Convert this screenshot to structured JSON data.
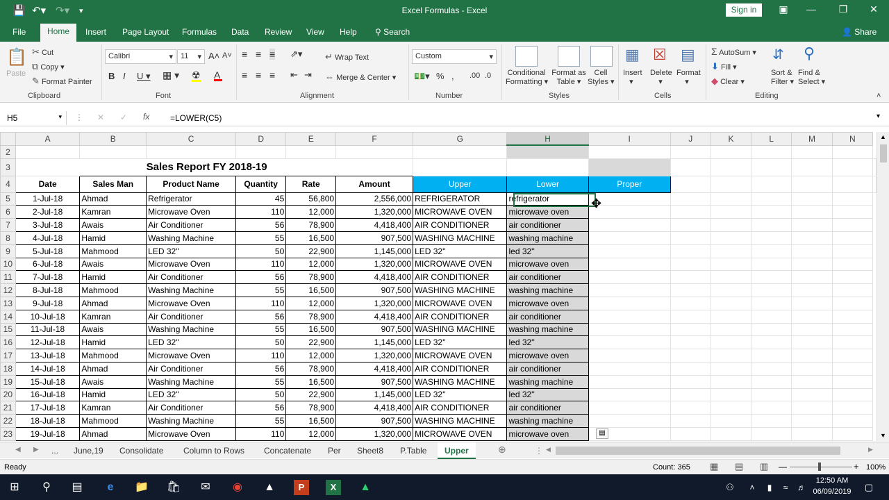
{
  "app": {
    "title": "Excel Formulas  -  Excel",
    "signin": "Sign in"
  },
  "tabs": [
    "File",
    "Home",
    "Insert",
    "Page Layout",
    "Formulas",
    "Data",
    "Review",
    "View",
    "Help"
  ],
  "tell_me": "Search",
  "share": "Share",
  "ribbon": {
    "clipboard": {
      "label": "Clipboard",
      "paste": "Paste",
      "cut": "Cut",
      "copy": "Copy",
      "format_painter": "Format Painter"
    },
    "font": {
      "label": "Font",
      "name": "Calibri",
      "size": "11"
    },
    "alignment": {
      "label": "Alignment",
      "wrap": "Wrap Text",
      "merge": "Merge & Center"
    },
    "number": {
      "label": "Number",
      "format": "Custom"
    },
    "styles": {
      "label": "Styles",
      "conditional": "Conditional",
      "conditional2": "Formatting",
      "format_as": "Format as",
      "format_as2": "Table",
      "cell": "Cell",
      "cell2": "Styles"
    },
    "cells": {
      "label": "Cells",
      "insert": "Insert",
      "delete": "Delete",
      "format": "Format"
    },
    "editing": {
      "label": "Editing",
      "autosum": "AutoSum",
      "fill": "Fill",
      "clear": "Clear",
      "sort": "Sort &",
      "sort2": "Filter",
      "find": "Find &",
      "find2": "Select"
    }
  },
  "formula_bar": {
    "name_box": "H5",
    "formula": "=LOWER(C5)",
    "fx": "fx"
  },
  "columns": [
    "A",
    "B",
    "C",
    "D",
    "E",
    "F",
    "G",
    "H",
    "I",
    "J",
    "K",
    "L",
    "M",
    "N"
  ],
  "sheet": {
    "title": "Sales Report FY 2018-19",
    "headers": [
      "Date",
      "Sales Man",
      "Product Name",
      "Quantity",
      "Rate",
      "Amount",
      "Upper",
      "Lower",
      "Proper"
    ],
    "rows": [
      [
        "5",
        "1-Jul-18",
        "Ahmad",
        "Refrigerator",
        "45",
        "56,800",
        "2,556,000",
        "REFRIGERATOR",
        "refrigerator"
      ],
      [
        "6",
        "2-Jul-18",
        "Kamran",
        "Microwave Oven",
        "110",
        "12,000",
        "1,320,000",
        "MICROWAVE OVEN",
        "microwave oven"
      ],
      [
        "7",
        "3-Jul-18",
        "Awais",
        "Air Conditioner",
        "56",
        "78,900",
        "4,418,400",
        "AIR CONDITIONER",
        "air conditioner"
      ],
      [
        "8",
        "4-Jul-18",
        "Hamid",
        "Washing Machine",
        "55",
        "16,500",
        "907,500",
        "WASHING MACHINE",
        "washing machine"
      ],
      [
        "9",
        "5-Jul-18",
        "Mahmood",
        "LED 32''",
        "50",
        "22,900",
        "1,145,000",
        "LED 32''",
        "led 32''"
      ],
      [
        "10",
        "6-Jul-18",
        "Awais",
        "Microwave Oven",
        "110",
        "12,000",
        "1,320,000",
        "MICROWAVE OVEN",
        "microwave oven"
      ],
      [
        "11",
        "7-Jul-18",
        "Hamid",
        "Air Conditioner",
        "56",
        "78,900",
        "4,418,400",
        "AIR CONDITIONER",
        "air conditioner"
      ],
      [
        "12",
        "8-Jul-18",
        "Mahmood",
        "Washing Machine",
        "55",
        "16,500",
        "907,500",
        "WASHING MACHINE",
        "washing machine"
      ],
      [
        "13",
        "9-Jul-18",
        "Ahmad",
        "Microwave Oven",
        "110",
        "12,000",
        "1,320,000",
        "MICROWAVE OVEN",
        "microwave oven"
      ],
      [
        "14",
        "10-Jul-18",
        "Kamran",
        "Air Conditioner",
        "56",
        "78,900",
        "4,418,400",
        "AIR CONDITIONER",
        "air conditioner"
      ],
      [
        "15",
        "11-Jul-18",
        "Awais",
        "Washing Machine",
        "55",
        "16,500",
        "907,500",
        "WASHING MACHINE",
        "washing machine"
      ],
      [
        "16",
        "12-Jul-18",
        "Hamid",
        "LED 32''",
        "50",
        "22,900",
        "1,145,000",
        "LED 32''",
        "led 32''"
      ],
      [
        "17",
        "13-Jul-18",
        "Mahmood",
        "Microwave Oven",
        "110",
        "12,000",
        "1,320,000",
        "MICROWAVE OVEN",
        "microwave oven"
      ],
      [
        "18",
        "14-Jul-18",
        "Ahmad",
        "Air Conditioner",
        "56",
        "78,900",
        "4,418,400",
        "AIR CONDITIONER",
        "air conditioner"
      ],
      [
        "19",
        "15-Jul-18",
        "Awais",
        "Washing Machine",
        "55",
        "16,500",
        "907,500",
        "WASHING MACHINE",
        "washing machine"
      ],
      [
        "20",
        "16-Jul-18",
        "Hamid",
        "LED 32''",
        "50",
        "22,900",
        "1,145,000",
        "LED 32''",
        "led 32''"
      ],
      [
        "21",
        "17-Jul-18",
        "Kamran",
        "Air Conditioner",
        "56",
        "78,900",
        "4,418,400",
        "AIR CONDITIONER",
        "air conditioner"
      ],
      [
        "22",
        "18-Jul-18",
        "Mahmood",
        "Washing Machine",
        "55",
        "16,500",
        "907,500",
        "WASHING MACHINE",
        "washing machine"
      ],
      [
        "23",
        "19-Jul-18",
        "Ahmad",
        "Microwave Oven",
        "110",
        "12,000",
        "1,320,000",
        "MICROWAVE OVEN",
        "microwave oven"
      ]
    ]
  },
  "sheet_tabs": [
    "...",
    "June,19",
    "Consolidate",
    "Column to Rows",
    "Concatenate",
    "Per",
    "Sheet8",
    "P.Table",
    "Upper"
  ],
  "status": {
    "ready": "Ready",
    "count": "Count: 365",
    "zoom": "100%"
  },
  "taskbar": {
    "time": "12:50 AM",
    "date": "06/09/2019"
  },
  "colors": {
    "accent": "#217346",
    "header_fill": "#00b0f0"
  }
}
